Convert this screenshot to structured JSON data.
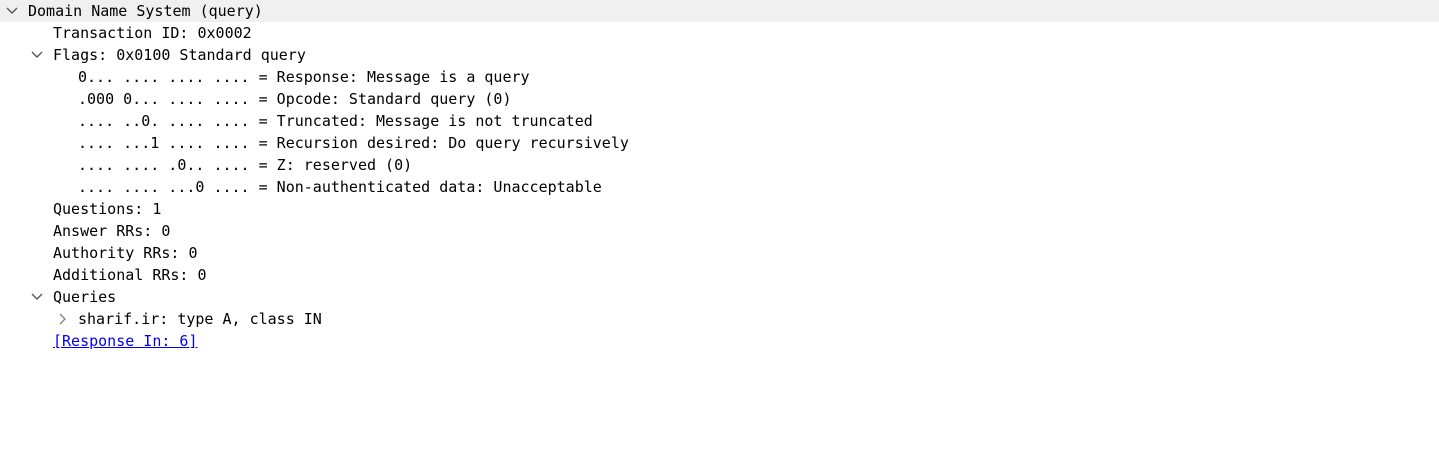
{
  "tree": {
    "dns_root": "Domain Name System (query)",
    "transaction_id": "Transaction ID: 0x0002",
    "flags": {
      "label": "Flags: 0x0100 Standard query",
      "items": [
        "0... .... .... .... = Response: Message is a query",
        ".000 0... .... .... = Opcode: Standard query (0)",
        ".... ..0. .... .... = Truncated: Message is not truncated",
        ".... ...1 .... .... = Recursion desired: Do query recursively",
        ".... .... .0.. .... = Z: reserved (0)",
        ".... .... ...0 .... = Non-authenticated data: Unacceptable"
      ]
    },
    "questions": "Questions: 1",
    "answer_rrs": "Answer RRs: 0",
    "authority_rrs": "Authority RRs: 0",
    "additional_rrs": "Additional RRs: 0",
    "queries": {
      "label": "Queries",
      "items": [
        "sharif.ir: type A, class IN"
      ]
    },
    "response_in": "[Response In: 6]"
  },
  "icons": {
    "expanded": "chevron-down-icon",
    "collapsed": "chevron-right-icon"
  },
  "colors": {
    "selected_row_bg": "#f0f0f0",
    "link": "#0000ee",
    "chevron": "#555555"
  }
}
